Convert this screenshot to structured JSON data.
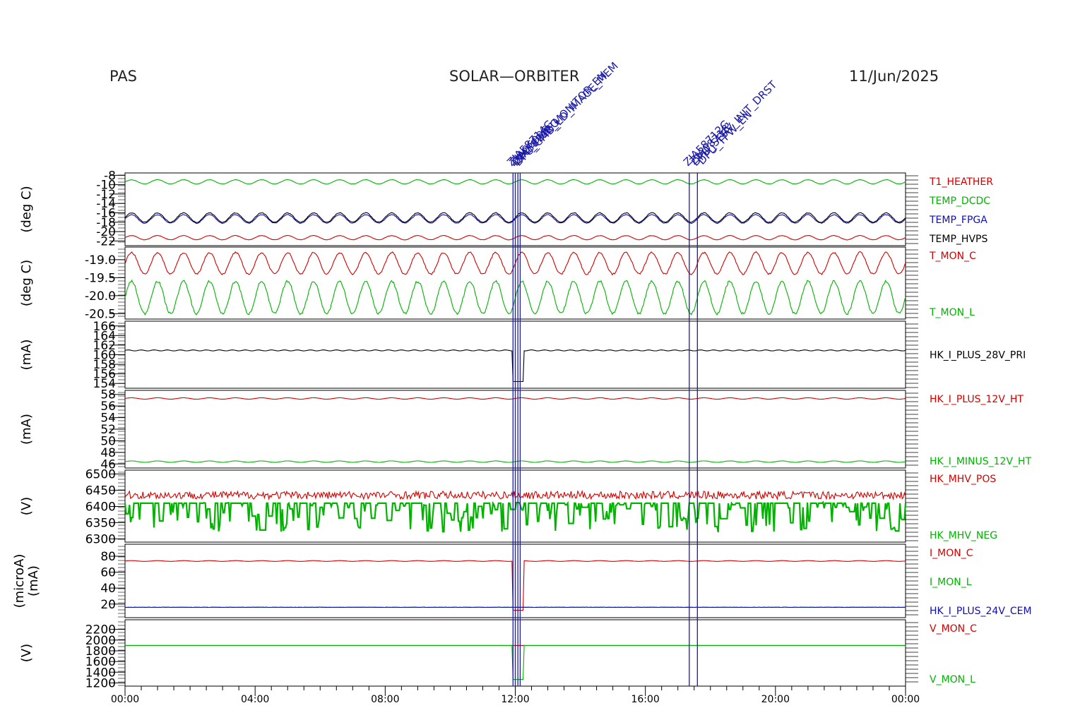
{
  "header": {
    "left": "PAS",
    "center": "SOLAR—ORBITER",
    "right": "11/Jun/2025"
  },
  "colors": {
    "red": "#d40000",
    "green": "#00b400",
    "blue": "#1010b0",
    "black": "#000000",
    "event": "#1a1aa8"
  },
  "chart_data": [
    {
      "type": "line",
      "ylabel": "(deg C)",
      "ticks": [
        "-8",
        "-10",
        "-12",
        "-14",
        "-16",
        "-18",
        "-20",
        "-22"
      ],
      "ylim": [
        -23,
        -7.5
      ],
      "series": [
        {
          "name": "T1_HEATHER",
          "color": "#d40000",
          "mean": -21.3,
          "amp": 0.45,
          "cycles": 30
        },
        {
          "name": "TEMP_DCDC",
          "color": "#00b400",
          "mean": -9.4,
          "amp": 0.45,
          "cycles": 30
        },
        {
          "name": "TEMP_FPGA",
          "color": "#1010b0",
          "mean": -17.3,
          "amp": 0.9,
          "cycles": 30
        },
        {
          "name": "TEMP_HVPS",
          "color": "#000000",
          "mean": -17.0,
          "amp": 1.0,
          "cycles": 30
        }
      ]
    },
    {
      "type": "line",
      "ylabel": "(deg C)",
      "ticks": [
        "-19.0",
        "-19.5",
        "-20.0",
        "-20.5"
      ],
      "ylim": [
        -20.65,
        -18.65
      ],
      "series": [
        {
          "name": "T_MON_C",
          "color": "#d40000",
          "mean": -19.1,
          "amp": 0.3,
          "cycles": 30
        },
        {
          "name": "T_MON_L",
          "color": "#00b400",
          "mean": -20.05,
          "amp": 0.45,
          "cycles": 30
        }
      ]
    },
    {
      "type": "line",
      "ylabel": "(mA)",
      "ticks": [
        "166",
        "164",
        "162",
        "160",
        "158",
        "156",
        "154"
      ],
      "ylim": [
        153,
        167
      ],
      "series": [
        {
          "name": "HK_I_PLUS_28V_PRI",
          "color": "#000000",
          "mean": 160.9,
          "amp": 0.1,
          "cycles": 60
        }
      ]
    },
    {
      "type": "line",
      "ylabel": "(mA)",
      "ticks": [
        "58",
        "56",
        "54",
        "52",
        "50",
        "48",
        "46"
      ],
      "ylim": [
        45.3,
        58.7
      ],
      "series": [
        {
          "name": "HK_I_PLUS_12V_HT",
          "color": "#d40000",
          "mean": 57.3,
          "amp": 0.12,
          "cycles": 30
        },
        {
          "name": "HK_I_MINUS_12V_HT",
          "color": "#00b400",
          "mean": 46.4,
          "amp": 0.12,
          "cycles": 30
        }
      ]
    },
    {
      "type": "line",
      "ylabel": "(V)",
      "ticks": [
        "6500",
        "6450",
        "6400",
        "6350",
        "6300"
      ],
      "ylim": [
        6290,
        6512
      ],
      "series": [
        {
          "name": "HK_MHV_POS",
          "color": "#d40000",
          "mean": 6435,
          "amp": 12,
          "cycles": 0
        },
        {
          "name": "HK_MHV_NEG",
          "color": "#00b400",
          "mean": 6405,
          "amp": 55,
          "cycles": 0
        }
      ]
    },
    {
      "type": "line",
      "ylabel": "(microA)\n(mA)",
      "ticks": [
        "80",
        "60",
        "40",
        "20"
      ],
      "ylim": [
        3,
        95
      ],
      "series": [
        {
          "name": "I_MON_C",
          "color": "#d40000",
          "mean": 74,
          "amp": 0.5,
          "cycles": 30
        },
        {
          "name": "I_MON_L",
          "color": "#00b400",
          "mean": 16,
          "amp": 0.2,
          "cycles": 0
        },
        {
          "name": "HK_I_PLUS_24V_CEM",
          "color": "#1010b0",
          "mean": 16,
          "amp": 0.2,
          "cycles": 0
        }
      ]
    },
    {
      "type": "line",
      "ylabel": "(V)",
      "ticks": [
        "2200",
        "2000",
        "1800",
        "1600",
        "1400",
        "1200"
      ],
      "ylim": [
        1140,
        2380
      ],
      "series": [
        {
          "name": "V_MON_C",
          "color": "#d40000",
          "mean": 1900,
          "amp": 0,
          "cycles": 0
        },
        {
          "name": "V_MON_L",
          "color": "#00b400",
          "mean": 1900,
          "amp": 0,
          "cycles": 0
        }
      ]
    }
  ],
  "x_axis": {
    "range_hours": [
      0,
      24
    ],
    "ticks": [
      "00:00",
      "04:00",
      "08:00",
      "12:00",
      "16:00",
      "20:00",
      "00:00"
    ]
  },
  "events": [
    {
      "time_h": 11.93,
      "labels": [
        "ZIA58714G",
        "ZIA58712G"
      ]
    },
    {
      "time_h": 12.0,
      "labels": [
        "ZIA06006"
      ]
    },
    {
      "time_h": 12.08,
      "labels": [
        "DPU_FDIR_MONITOR_EN"
      ]
    },
    {
      "time_h": 12.15,
      "labels": [
        "DPU_CMD_LD_IMAGE_MEM"
      ]
    },
    {
      "time_h": 17.35,
      "labels": [
        "ZIA58712G",
        "ZIA08718"
      ]
    },
    {
      "time_h": 17.6,
      "labels": [
        "DPU_SERV_INIT_DRST",
        "DPU_TPW_EN"
      ]
    }
  ]
}
